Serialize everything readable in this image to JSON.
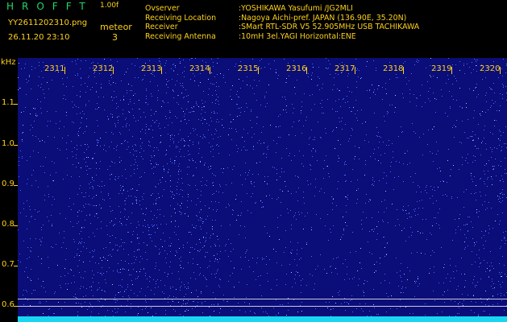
{
  "header": {
    "logo_text": "HROFFT",
    "version": "1.00f",
    "filename": "YY2611202310.png",
    "datetime": "26.11.20 23:10",
    "meteor_label": "meteor",
    "meteor_count": "3",
    "info": [
      {
        "key": "Ovserver",
        "value": ":YOSHIKAWA Yasufumi /JG2MLI"
      },
      {
        "key": "Receiving Location",
        "value": ":Nagoya Aichi-pref. JAPAN (136.90E, 35.20N)"
      },
      {
        "key": "Receiver",
        "value": ":SMart RTL-SDR V5 52.905MHz USB TACHIKAWA"
      },
      {
        "key": "Receiving Antenna",
        "value": ":10mH 3el.YAGI Horizontal:ENE"
      }
    ]
  },
  "axis": {
    "y_unit": "kHz",
    "y_ticks": [
      "1.1",
      "1.0",
      "0.9",
      "0.8",
      "0.7",
      "0.6"
    ],
    "x_ticks": [
      "2311",
      "2312",
      "2313",
      "2314",
      "2315",
      "2316",
      "2317",
      "2318",
      "2319",
      "2320"
    ]
  },
  "colors": {
    "text": "#ffd21a",
    "logo": "#22d86b",
    "background": "#0b0d78",
    "noise": "#4a6cff",
    "baseline": "#18d6f2"
  }
}
